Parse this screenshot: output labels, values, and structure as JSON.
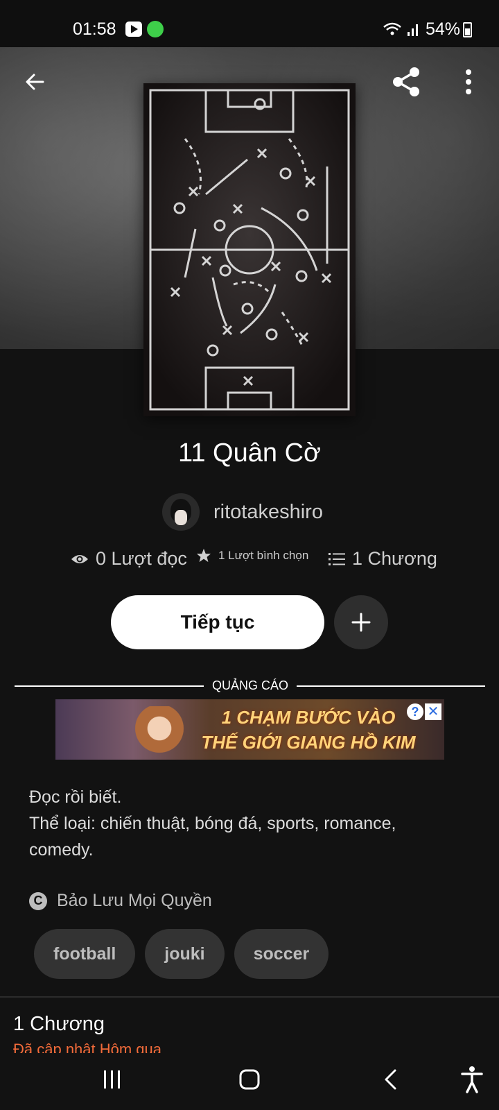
{
  "status_bar": {
    "time": "01:58",
    "battery": "54%"
  },
  "book": {
    "title": "11 Quân Cờ",
    "author": "ritotakeshiro",
    "stats": {
      "reads": "0 Lượt đọc",
      "votes": "1 Lượt bình chọn",
      "chapters": "1 Chương"
    },
    "continue_label": "Tiếp tục",
    "description_lines": [
      "Đọc rồi biết.",
      "Thể loại: chiến thuật, bóng đá, sports, romance,",
      "comedy."
    ],
    "copyright": "Bảo Lưu Mọi Quyền",
    "tags": [
      "football",
      "jouki",
      "soccer"
    ]
  },
  "ad": {
    "label": "QUẢNG CÁO",
    "headline_1": "1 CHẠM BƯỚC VÀO",
    "headline_2": "THẾ GIỚI GIANG HỒ KIM DUNG",
    "info_glyph": "?",
    "close_glyph": "✕"
  },
  "chapters_section": {
    "title": "1 Chương",
    "updated": "Đã cập nhật Hôm qua"
  },
  "icons": {
    "back": "arrow-left",
    "share": "share",
    "more": "more-vertical",
    "eye": "eye",
    "star": "star",
    "list": "list",
    "plus": "plus",
    "copyright": "copyright"
  },
  "colors": {
    "background": "#121212",
    "accent_orange": "#f26b3a",
    "button_white": "#ffffff"
  }
}
